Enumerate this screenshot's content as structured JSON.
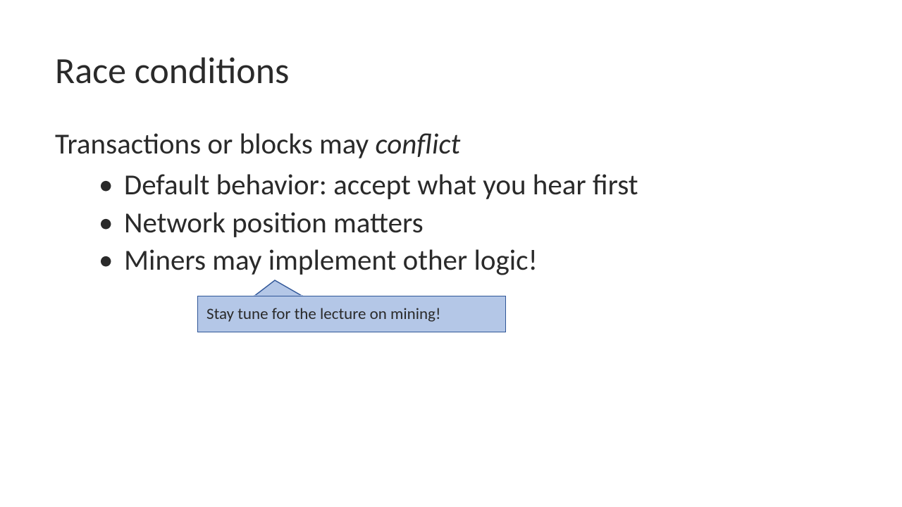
{
  "slide": {
    "title": "Race conditions",
    "lead_prefix": "Transactions or blocks may ",
    "lead_emphasis": "conflict",
    "bullets": [
      "Default behavior: accept what you hear first",
      "Network position matters",
      "Miners may implement other logic!"
    ],
    "callout": "Stay tune for the lecture on mining!"
  },
  "colors": {
    "callout_fill": "#b4c7e7",
    "callout_border": "#2f5597"
  }
}
